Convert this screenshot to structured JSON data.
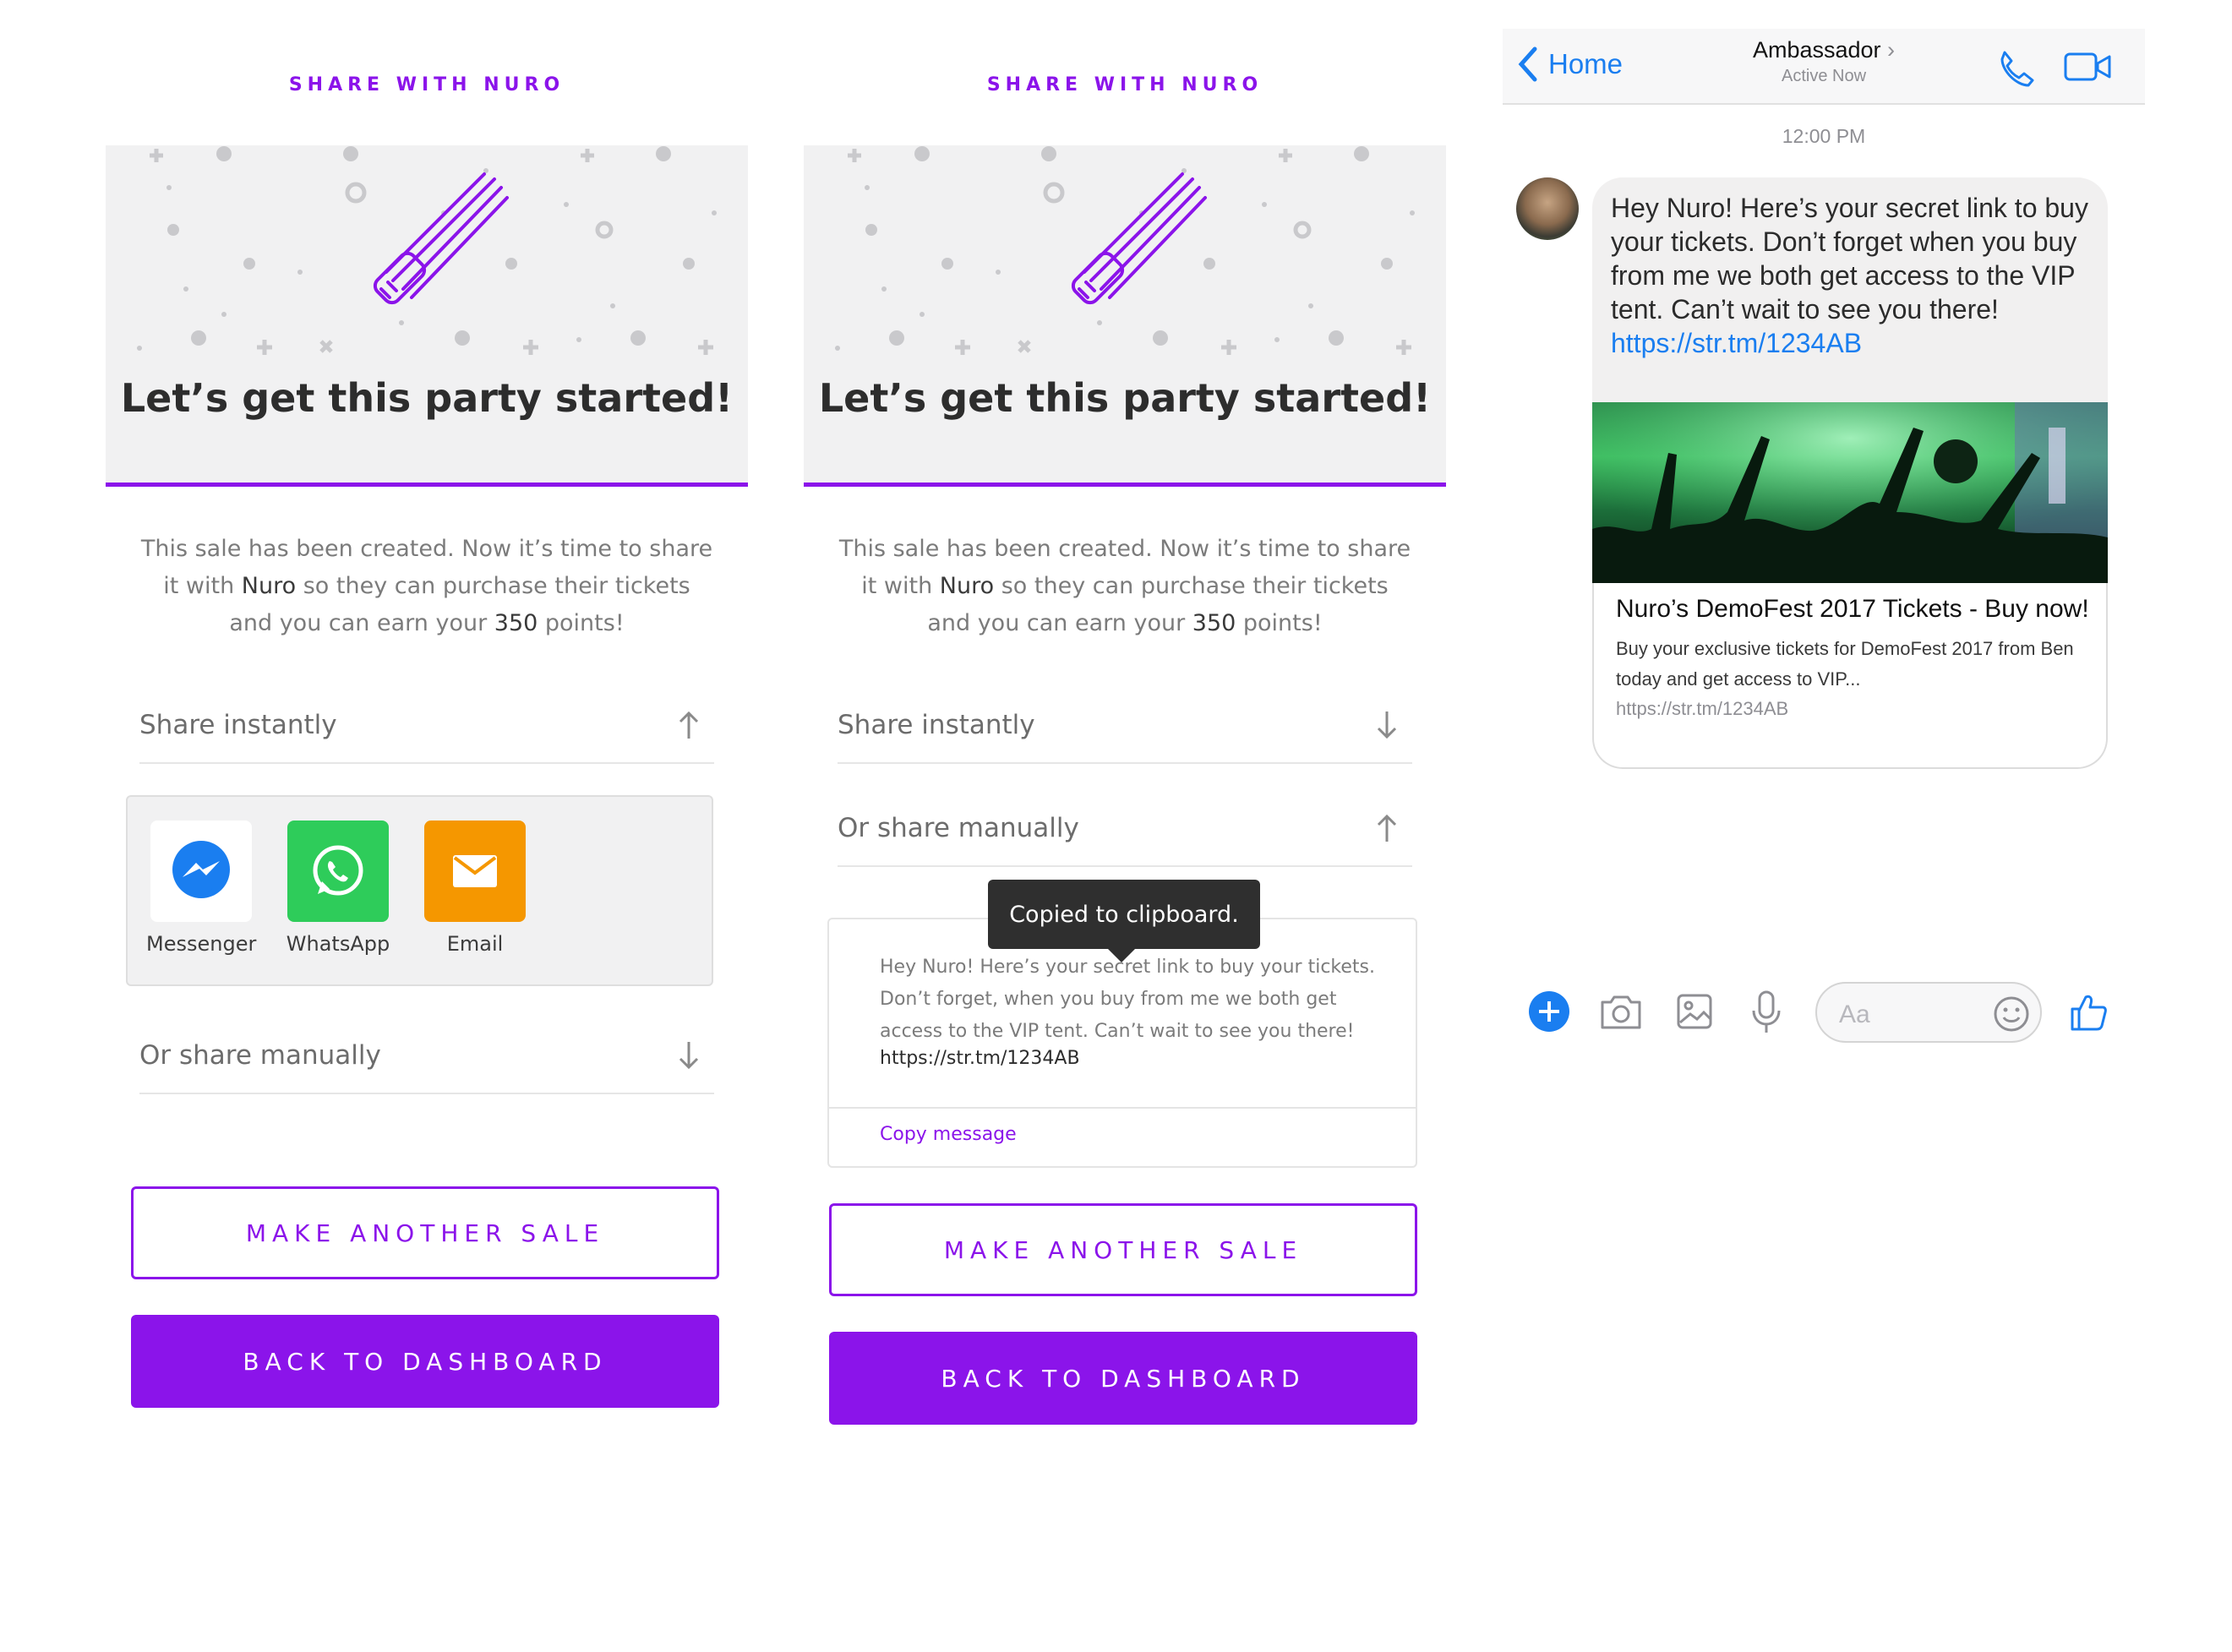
{
  "screen1": {
    "eyebrow": "SHARE WITH NURO",
    "hero_title": "Let’s get this party started!",
    "intro": {
      "line1": "This sale has been created. Now it’s time to share",
      "line2_a": "it with ",
      "line2_name": "Nuro",
      "line2_b": " so they can purchase their tickets",
      "line3_a": "and you can earn your ",
      "line3_points": "350",
      "line3_b": " points!"
    },
    "share_instantly": "Share instantly",
    "apps": [
      {
        "label": "Messenger",
        "icon": "messenger-icon",
        "color": "#ffffff"
      },
      {
        "label": "WhatsApp",
        "icon": "whatsapp-icon",
        "color": "#2ecc5a"
      },
      {
        "label": "Email",
        "icon": "email-icon",
        "color": "#f59700"
      }
    ],
    "share_manually": "Or share manually",
    "make_another_sale": "MAKE ANOTHER SALE",
    "back_to_dashboard": "BACK TO DASHBOARD"
  },
  "screen2": {
    "eyebrow": "SHARE WITH NURO",
    "hero_title": "Let’s get this party started!",
    "intro": {
      "line1": "This sale has been created. Now it’s time to share",
      "line2_a": "it with ",
      "line2_name": "Nuro",
      "line2_b": " so they can purchase their tickets",
      "line3_a": "and you can earn your ",
      "line3_points": "350",
      "line3_b": " points!"
    },
    "share_instantly": "Share instantly",
    "share_manually": "Or share manually",
    "tooltip": "Copied to clipboard.",
    "message": "Hey Nuro! Here’s your secret link to buy your tickets. Don’t forget, when you buy from me we both get access to the VIP tent. Can’t wait to see you there!",
    "message_link": "https://str.tm/1234AB",
    "copy_message": "Copy message",
    "make_another_sale": "MAKE ANOTHER SALE",
    "back_to_dashboard": "BACK TO DASHBOARD"
  },
  "messenger": {
    "back_label": "Home",
    "contact_name": "Ambassador",
    "status": "Active Now",
    "time": "12:00 PM",
    "message": "Hey Nuro! Here’s your secret link to buy your tickets. Don’t forget when you buy from me we both get access to the VIP tent. Can’t wait to see you there!",
    "link": "https://str.tm/1234AB",
    "card_title": "Nuro’s DemoFest 2017 Tickets - Buy now!",
    "card_desc": "Buy your exclusive tickets for DemoFest 2017 from Ben today and get access to VIP...",
    "card_url": "https://str.tm/1234AB",
    "input_placeholder": "Aa"
  },
  "colors": {
    "brand_purple": "#8b14ea",
    "messenger_blue": "#1a7ef0"
  }
}
